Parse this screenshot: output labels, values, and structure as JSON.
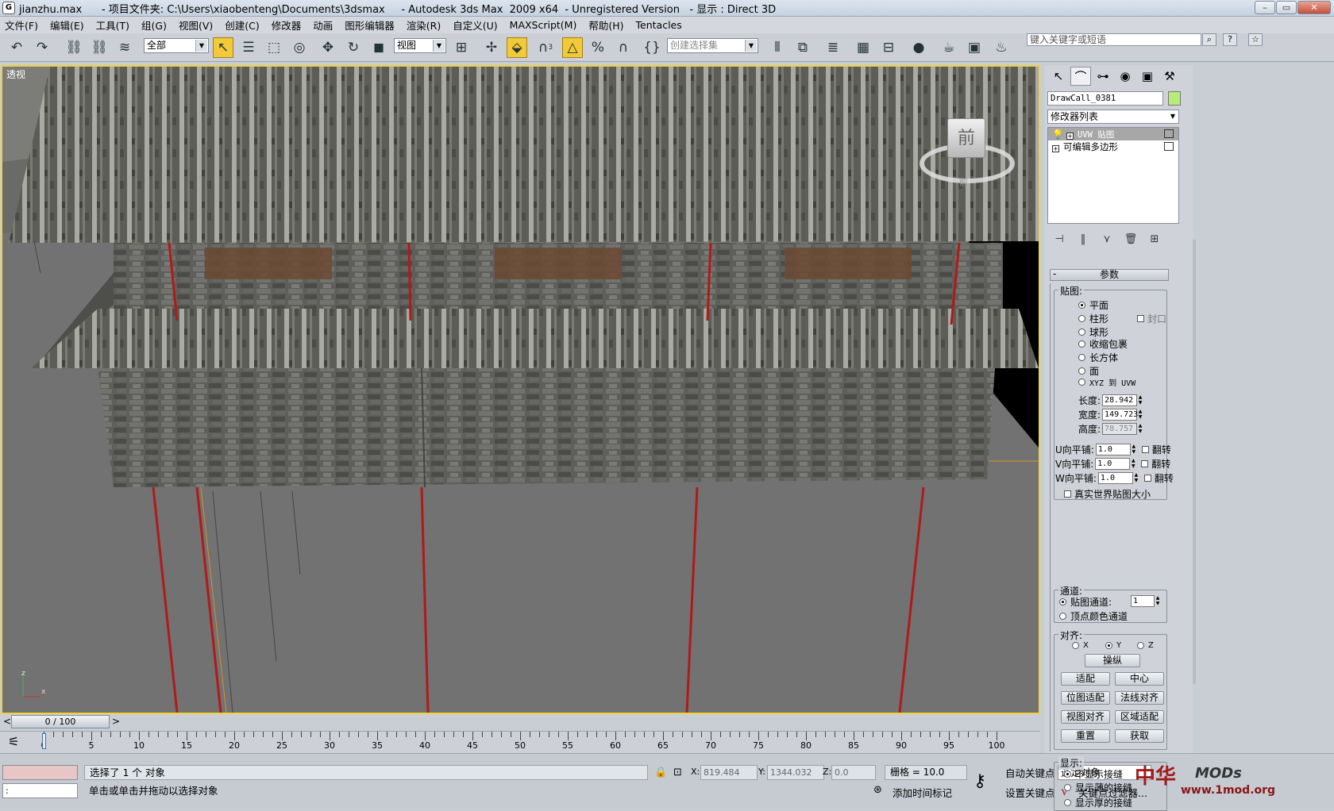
{
  "window": {
    "title": "jianzhu.max      - 项目文件夹: C:\\Users\\xiaobenteng\\Documents\\3dsmax     - Autodesk 3ds Max  2009 x64  - Unregistered Version   - 显示 : Direct 3D",
    "icon": "G",
    "buttons": {
      "min": "–",
      "max": "▭",
      "close": "✕"
    }
  },
  "menu": [
    "文件(F)",
    "编辑(E)",
    "工具(T)",
    "组(G)",
    "视图(V)",
    "创建(C)",
    "修改器",
    "动画",
    "图形编辑器",
    "渲染(R)",
    "自定义(U)",
    "MAXScript(M)",
    "帮助(H)",
    "Tentacles"
  ],
  "toolbar": {
    "filter_select": "全部",
    "ref_coord": "视图",
    "named_sel": "创建选择集",
    "snap_num": "3",
    "search_placeholder": "键入关键字或短语",
    "search_icon": "⌕",
    "help_icon": "?",
    "star_icon": "☆"
  },
  "viewport": {
    "label": "透视",
    "navcube_face": "前",
    "navcube_back": "前",
    "axis_z": "z",
    "axis_x": "x"
  },
  "timeline": {
    "slider": "0 / 100",
    "ticks": [
      "0",
      "5",
      "10",
      "15",
      "20",
      "25",
      "30",
      "35",
      "40",
      "45",
      "50",
      "55",
      "60",
      "65",
      "70",
      "75",
      "80",
      "85",
      "90",
      "95",
      "100"
    ]
  },
  "command_panel": {
    "object_name": "DrawCall_0381",
    "object_color": "#b8ec78",
    "modifier_list": "修改器列表",
    "stack": [
      {
        "label": "UVW 贴图",
        "selected": true
      },
      {
        "label": "可编辑多边形",
        "selected": false
      }
    ],
    "params_title": "参数",
    "params_collapse": "-",
    "mapping_group": "贴图:",
    "mapping_options": [
      "平面",
      "柱形",
      "球形",
      "收缩包裹",
      "长方体",
      "面",
      "XYZ 到 UVW"
    ],
    "cap_label": "封口",
    "length_label": "长度:",
    "length_val": "28.942",
    "width_label": "宽度:",
    "width_val": "149.723",
    "height_label": "高度:",
    "height_val": "78.757",
    "u_tile_label": "U向平铺:",
    "u_tile": "1.0",
    "v_tile_label": "V向平铺:",
    "v_tile": "1.0",
    "w_tile_label": "W向平铺:",
    "w_tile": "1.0",
    "flip_label": "翻转",
    "real_world": "真实世界贴图大小",
    "channel_group": "通道:",
    "map_channel": "贴图通道:",
    "map_channel_val": "1",
    "vertex_color": "顶点颜色通道",
    "align_group": "对齐:",
    "align_x": "X",
    "align_y": "Y",
    "align_z": "Z",
    "manipulate": "操纵",
    "fit": "适配",
    "center": "中心",
    "bitmap_fit": "位图适配",
    "normal_align": "法线对齐",
    "view_align": "视图对齐",
    "region_fit": "区域适配",
    "reset": "重置",
    "acquire": "获取",
    "display_group": "显示:",
    "display_options": [
      "不显示接缝",
      "显示薄的接缝",
      "显示厚的接缝"
    ]
  },
  "status": {
    "selected_msg": "选择了 1 个 对象",
    "hint_msg": "单击或单击并拖动以选择对象",
    "prompt": ":",
    "x_label": "X:",
    "x_val": "819.484",
    "y_label": "Y:",
    "y_val": "1344.032",
    "z_label": "Z:",
    "z_val": "0.0",
    "grid": "栅格 = 10.0",
    "add_time_tag": "添加时间标记",
    "auto_key": "自动关键点",
    "set_key": "设置关键点",
    "selected_obj": "选定对象",
    "key_filters": "关键点过滤器...",
    "watermark_cn": "中华",
    "watermark_mods": "MODs",
    "watermark_site": "www.1mod.org"
  }
}
